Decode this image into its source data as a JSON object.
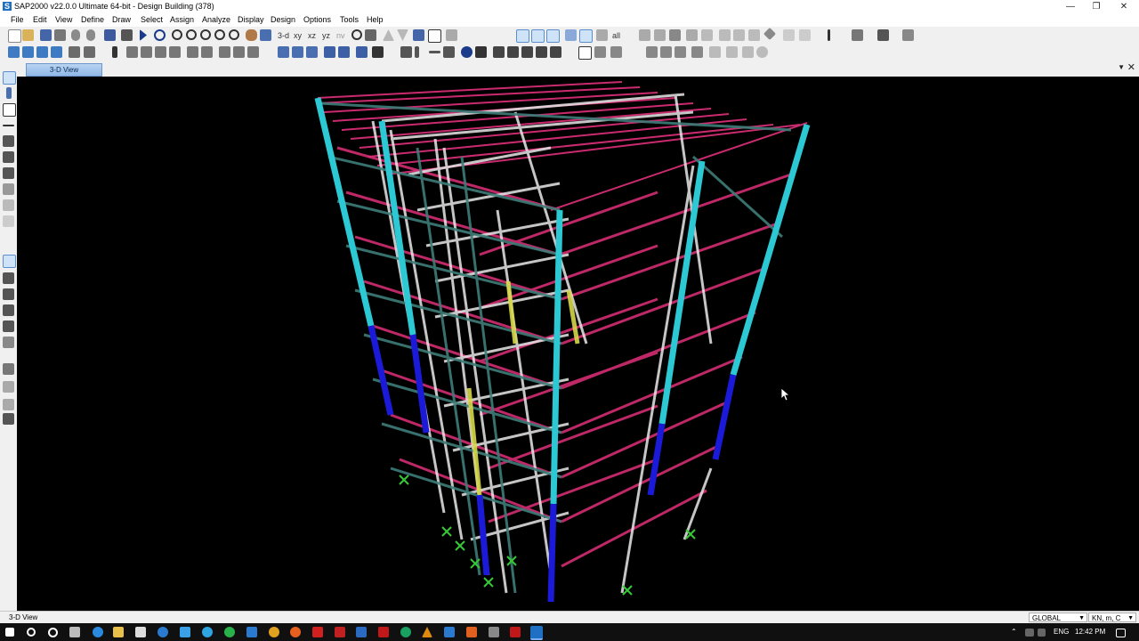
{
  "window": {
    "title": "SAP2000 v22.0.0 Ultimate 64-bit - Design Building (378)",
    "logo": "S"
  },
  "menu": [
    "File",
    "Edit",
    "View",
    "Define",
    "Draw",
    "Select",
    "Assign",
    "Analyze",
    "Display",
    "Design",
    "Options",
    "Tools",
    "Help"
  ],
  "toolbar": {
    "view_3d": "3-d",
    "view_xy": "xy",
    "view_xz": "xz",
    "view_yz": "yz",
    "view_nv": "nv",
    "all_label": "all"
  },
  "tab": {
    "label": "3-D View"
  },
  "status": {
    "left": "3-D View",
    "coord_system": "GLOBAL",
    "units": "KN, m, C"
  },
  "taskbar": {
    "lang": "ENG",
    "time": "12:42 PM"
  },
  "colors": {
    "viewport_bg": "#000000",
    "frame_magenta": "#e0307a",
    "column_cyan": "#2cc9d4",
    "column_blue": "#1a1ad8",
    "brace_white": "#e8e8e8",
    "brace_green": "#3d7d78",
    "support_green": "#36c936",
    "highlight_yellow": "#d8d84a"
  }
}
